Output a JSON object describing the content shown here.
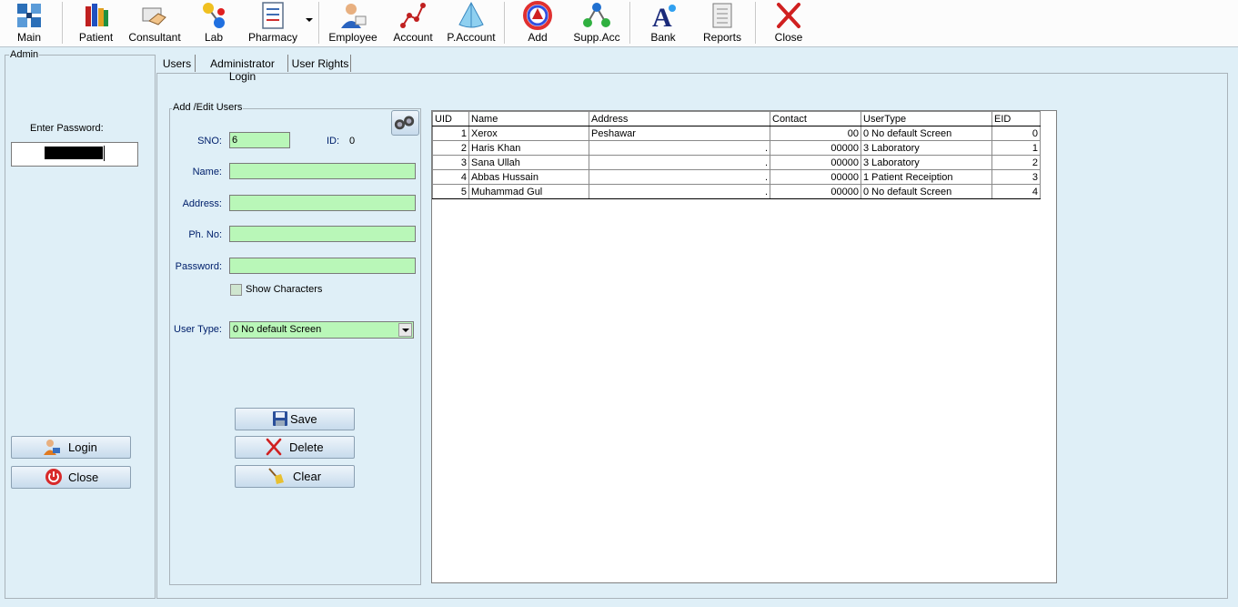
{
  "toolbar": {
    "buttons": [
      {
        "label": "Main",
        "icon": "grid-modules-icon"
      },
      {
        "label": "Patient",
        "icon": "books-icon"
      },
      {
        "label": "Consultant",
        "icon": "handshake-icon"
      },
      {
        "label": "Lab",
        "icon": "molecule-icon"
      },
      {
        "label": "Pharmacy",
        "icon": "checklist-icon"
      },
      {
        "label": "Employee",
        "icon": "employee-icon"
      },
      {
        "label": "Account",
        "icon": "graph-icon"
      },
      {
        "label": "P.Account",
        "icon": "pyramid-icon"
      },
      {
        "label": "Add",
        "icon": "color-wheel-icon"
      },
      {
        "label": "Supp.Acc",
        "icon": "network-icon"
      },
      {
        "label": "Bank",
        "icon": "font-a-icon"
      },
      {
        "label": "Reports",
        "icon": "scroll-icon"
      },
      {
        "label": "Close",
        "icon": "close-x-icon"
      }
    ]
  },
  "admin": {
    "caption": "Admin",
    "password_label": "Enter Password:",
    "login_label": "Login",
    "close_label": "Close"
  },
  "tabs": [
    {
      "label": "Users",
      "active": true
    },
    {
      "label": "Administrator Login",
      "active": false
    },
    {
      "label": "User Rights",
      "active": false
    }
  ],
  "form": {
    "caption": "Add /Edit Users",
    "sno_label": "SNO:",
    "sno_value": "6",
    "id_label": "ID:",
    "id_value": "0",
    "name_label": "Name:",
    "name_value": "",
    "address_label": "Address:",
    "address_value": "",
    "phone_label": "Ph. No:",
    "phone_value": "",
    "password_label": "Password:",
    "password_value": "",
    "show_chars_label": "Show Characters",
    "user_type_label": "User Type:",
    "user_type_value": "0   No default Screen",
    "save_label": "Save",
    "delete_label": "Delete",
    "clear_label": "Clear"
  },
  "grid": {
    "columns": [
      "UID",
      "Name",
      "Address",
      "Contact",
      "UserType",
      "EID"
    ],
    "rows": [
      [
        "1",
        "Xerox",
        "Peshawar",
        "00",
        "0   No default Screen",
        "0"
      ],
      [
        "2",
        "Haris Khan",
        ".",
        "00000",
        "3   Laboratory",
        "1"
      ],
      [
        "3",
        "Sana Ullah",
        ".",
        "00000",
        "3   Laboratory",
        "2"
      ],
      [
        "4",
        "Abbas Hussain",
        ".",
        "00000",
        "1   Patient Receiption",
        "3"
      ],
      [
        "5",
        "Muhammad Gul",
        ".",
        "00000",
        "0   No default Screen",
        "4"
      ]
    ]
  },
  "colors": {
    "window_bg": "#dfeff7",
    "input_green": "#b9f7b8",
    "label_blue": "#00206c"
  }
}
